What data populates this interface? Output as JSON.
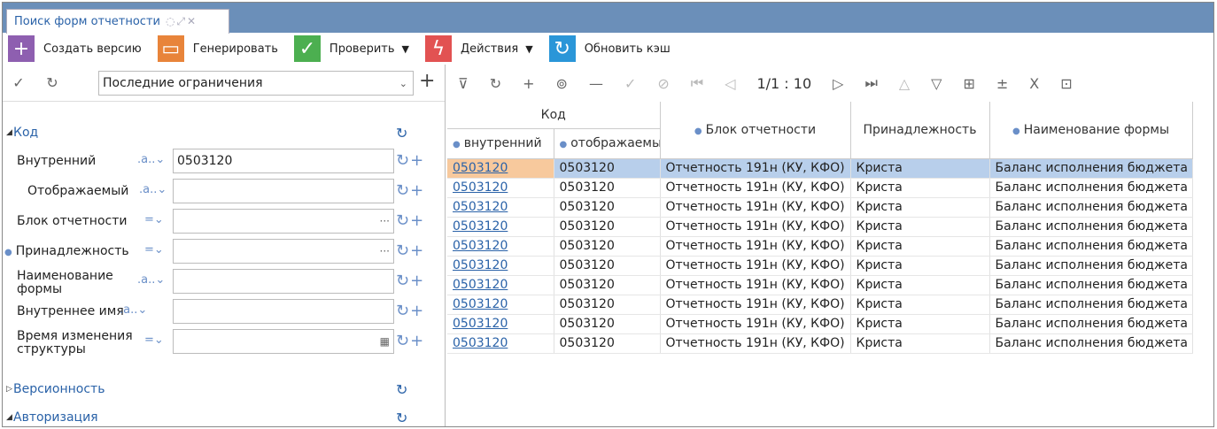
{
  "tab": {
    "title": "Поиск форм отчетности",
    "icons": "◌⤢✕"
  },
  "toolbar": [
    {
      "label": "Создать версию",
      "icon": "+",
      "color": "#8e5fb0"
    },
    {
      "label": "Генерировать",
      "icon": "▭",
      "color": "#e8843a"
    },
    {
      "label": "Проверить",
      "icon": "✓",
      "color": "#4caf50",
      "dropdown": "▼"
    },
    {
      "label": "Действия",
      "icon": "ϟ",
      "color": "#e25252",
      "dropdown": "▼"
    },
    {
      "label": "Обновить кэш",
      "icon": "↻",
      "color": "#2a96d8"
    }
  ],
  "left": {
    "restriction": "Последние ограничения",
    "sections": {
      "kod": "Код",
      "versions": "Версионность",
      "auth": "Авторизация"
    },
    "fields": [
      {
        "label": "Внутренний",
        "op": ".a..⌄",
        "value": "0503120",
        "trail": ""
      },
      {
        "label": "Отображаемый",
        "op": ".a..⌄",
        "value": "",
        "trail": ""
      },
      {
        "label": "Блок отчетности",
        "op": "=⌄",
        "value": "",
        "trail": "···"
      },
      {
        "label": "Принадлежность",
        "op": "=⌄",
        "value": "",
        "trail": "···"
      },
      {
        "label": "Наименование формы",
        "op": ".a..⌄",
        "value": "",
        "trail": ""
      },
      {
        "label": "Внутреннее имя",
        "op": ".a..⌄",
        "value": "",
        "trail": ""
      },
      {
        "label": "Время изменения структуры",
        "op": "=⌄",
        "value": "",
        "trail": "▦"
      }
    ]
  },
  "grid": {
    "pager": "1/1 : 10",
    "group": "Код",
    "headers": {
      "internal": "внутренний",
      "display": "отображаемый",
      "block": "Блок отчетности",
      "owner": "Принадлежность",
      "name": "Наименование формы"
    },
    "rows": [
      [
        "0503120",
        "0503120",
        "Отчетность 191н (КУ, КФО)",
        "Криста",
        "Баланс исполнения бюджета"
      ],
      [
        "0503120",
        "0503120",
        "Отчетность 191н (КУ, КФО)",
        "Криста",
        "Баланс исполнения бюджета"
      ],
      [
        "0503120",
        "0503120",
        "Отчетность 191н (КУ, КФО)",
        "Криста",
        "Баланс исполнения бюджета"
      ],
      [
        "0503120",
        "0503120",
        "Отчетность 191н (КУ, КФО)",
        "Криста",
        "Баланс исполнения бюджета"
      ],
      [
        "0503120",
        "0503120",
        "Отчетность 191н (КУ, КФО)",
        "Криста",
        "Баланс исполнения бюджета"
      ],
      [
        "0503120",
        "0503120",
        "Отчетность 191н (КУ, КФО)",
        "Криста",
        "Баланс исполнения бюджета"
      ],
      [
        "0503120",
        "0503120",
        "Отчетность 191н (КУ, КФО)",
        "Криста",
        "Баланс исполнения бюджета"
      ],
      [
        "0503120",
        "0503120",
        "Отчетность 191н (КУ, КФО)",
        "Криста",
        "Баланс исполнения бюджета"
      ],
      [
        "0503120",
        "0503120",
        "Отчетность 191н (КУ, КФО)",
        "Криста",
        "Баланс исполнения бюджета"
      ],
      [
        "0503120",
        "0503120",
        "Отчетность 191н (КУ, КФО)",
        "Криста",
        "Баланс исполнения бюджета"
      ]
    ]
  }
}
